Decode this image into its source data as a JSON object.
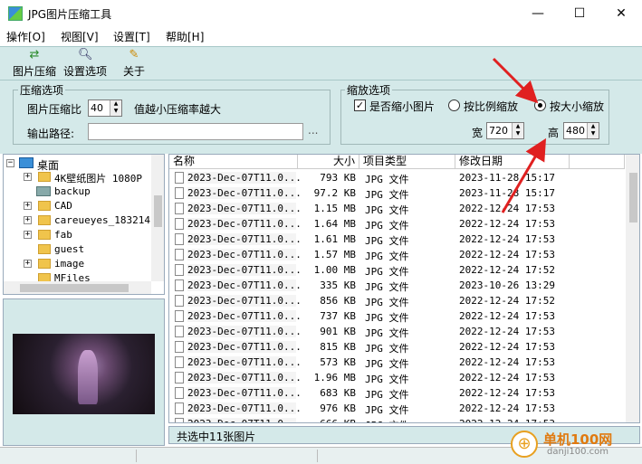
{
  "window": {
    "title": "JPG图片压缩工具",
    "min": "—",
    "max": "☐",
    "close": "✕"
  },
  "menu": [
    "操作[O]",
    "视图[V]",
    "设置[T]",
    "帮助[H]"
  ],
  "toolbar": {
    "compress": "图片压缩",
    "settings": "设置选项",
    "about": "关于"
  },
  "compress_group": {
    "title": "压缩选项",
    "ratio_label": "图片压缩比",
    "ratio_value": "40",
    "ratio_hint": "值越小压缩率越大",
    "output_label": "输出路径:",
    "output_value": "",
    "browse": "..."
  },
  "scale_group": {
    "title": "缩放选项",
    "shrink_label": "是否缩小图片",
    "shrink_checked": "✓",
    "ratio_mode": "按比例缩放",
    "size_mode": "按大小缩放",
    "width_label": "宽",
    "width_value": "720",
    "height_label": "高",
    "height_value": "480"
  },
  "tree": {
    "root": "桌面",
    "items": [
      "4K壁纸图片 1080P",
      "backup",
      "CAD",
      "careueyes_183214",
      "fab",
      "guest",
      "image",
      "MFiles"
    ]
  },
  "list": {
    "columns": {
      "name": "名称",
      "size": "大小",
      "type": "项目类型",
      "date": "修改日期"
    },
    "rows": [
      {
        "name": "2023-Dec-07T11.0...",
        "size": "793 KB",
        "type": "JPG 文件",
        "date": "2023-11-28 15:17"
      },
      {
        "name": "2023-Dec-07T11.0...",
        "size": "97.2 KB",
        "type": "JPG 文件",
        "date": "2023-11-28 15:17"
      },
      {
        "name": "2023-Dec-07T11.0...",
        "size": "1.15 MB",
        "type": "JPG 文件",
        "date": "2022-12-24 17:53"
      },
      {
        "name": "2023-Dec-07T11.0...",
        "size": "1.64 MB",
        "type": "JPG 文件",
        "date": "2022-12-24 17:53"
      },
      {
        "name": "2023-Dec-07T11.0...",
        "size": "1.61 MB",
        "type": "JPG 文件",
        "date": "2022-12-24 17:53"
      },
      {
        "name": "2023-Dec-07T11.0...",
        "size": "1.57 MB",
        "type": "JPG 文件",
        "date": "2022-12-24 17:53"
      },
      {
        "name": "2023-Dec-07T11.0...",
        "size": "1.00 MB",
        "type": "JPG 文件",
        "date": "2022-12-24 17:52"
      },
      {
        "name": "2023-Dec-07T11.0...",
        "size": "335 KB",
        "type": "JPG 文件",
        "date": "2023-10-26 13:29"
      },
      {
        "name": "2023-Dec-07T11.0...",
        "size": "856 KB",
        "type": "JPG 文件",
        "date": "2022-12-24 17:52"
      },
      {
        "name": "2023-Dec-07T11.0...",
        "size": "737 KB",
        "type": "JPG 文件",
        "date": "2022-12-24 17:53"
      },
      {
        "name": "2023-Dec-07T11.0...",
        "size": "901 KB",
        "type": "JPG 文件",
        "date": "2022-12-24 17:53"
      },
      {
        "name": "2023-Dec-07T11.0...",
        "size": "815 KB",
        "type": "JPG 文件",
        "date": "2022-12-24 17:53"
      },
      {
        "name": "2023-Dec-07T11.0...",
        "size": "573 KB",
        "type": "JPG 文件",
        "date": "2022-12-24 17:53"
      },
      {
        "name": "2023-Dec-07T11.0...",
        "size": "1.96 MB",
        "type": "JPG 文件",
        "date": "2022-12-24 17:53"
      },
      {
        "name": "2023-Dec-07T11.0...",
        "size": "683 KB",
        "type": "JPG 文件",
        "date": "2022-12-24 17:53"
      },
      {
        "name": "2023-Dec-07T11.0...",
        "size": "976 KB",
        "type": "JPG 文件",
        "date": "2022-12-24 17:53"
      },
      {
        "name": "2023-Dec-07T11.0...",
        "size": "666 KB",
        "type": "JPG 文件",
        "date": "2022-12-24 17:53"
      }
    ]
  },
  "status": "共选中11张图片",
  "watermark": {
    "site": "单机100网",
    "url": "danji100.com"
  },
  "colors": {
    "panel": "#d4e9e9",
    "annotation": "#e02020"
  }
}
